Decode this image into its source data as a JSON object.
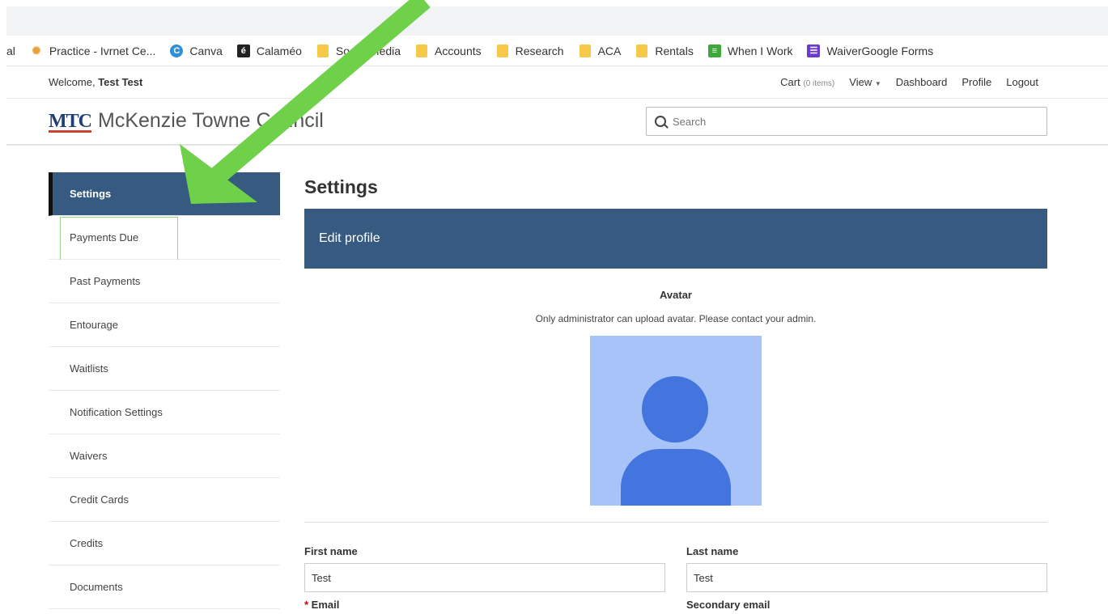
{
  "bookmarks": [
    {
      "label": "al",
      "icon": "none"
    },
    {
      "label": "Practice - Ivrnet Ce...",
      "icon": "practice-icon"
    },
    {
      "label": "Canva",
      "icon": "canva-icon"
    },
    {
      "label": "Calaméo",
      "icon": "calameo-icon"
    },
    {
      "label": "Social Media",
      "icon": "folder-icon"
    },
    {
      "label": "Accounts",
      "icon": "folder-icon"
    },
    {
      "label": "Research",
      "icon": "folder-icon"
    },
    {
      "label": "ACA",
      "icon": "folder-icon"
    },
    {
      "label": "Rentals",
      "icon": "folder-icon"
    },
    {
      "label": "When I Work",
      "icon": "wheniwork-icon"
    },
    {
      "label": "WaiverGoogle Forms",
      "icon": "google-forms-icon"
    }
  ],
  "userbar": {
    "welcome_prefix": "Welcome,",
    "user_name": "Test Test",
    "cart_label": "Cart",
    "cart_count": "(0 items)",
    "view_label": "View",
    "dashboard_label": "Dashboard",
    "profile_label": "Profile",
    "logout_label": "Logout"
  },
  "header": {
    "logo_mark": "MTC",
    "org_name": "McKenzie Towne Council",
    "search_placeholder": "Search"
  },
  "sidebar": {
    "items": [
      {
        "label": "Settings",
        "active": true
      },
      {
        "label": "Payments Due"
      },
      {
        "label": "Past Payments"
      },
      {
        "label": "Entourage"
      },
      {
        "label": "Waitlists"
      },
      {
        "label": "Notification Settings"
      },
      {
        "label": "Waivers"
      },
      {
        "label": "Credit Cards"
      },
      {
        "label": "Credits"
      },
      {
        "label": "Documents"
      }
    ]
  },
  "main": {
    "title": "Settings",
    "panel_title": "Edit profile",
    "avatar_label": "Avatar",
    "avatar_note": "Only administrator can upload avatar. Please contact your admin.",
    "first_name_label": "First name",
    "first_name_value": "Test",
    "last_name_label": "Last name",
    "last_name_value": "Test",
    "email_required": "* ",
    "email_label": "Email",
    "secondary_email_label": "Secondary email"
  },
  "colors": {
    "accent": "#365a80",
    "annotation_arrow": "#6fd04a"
  }
}
